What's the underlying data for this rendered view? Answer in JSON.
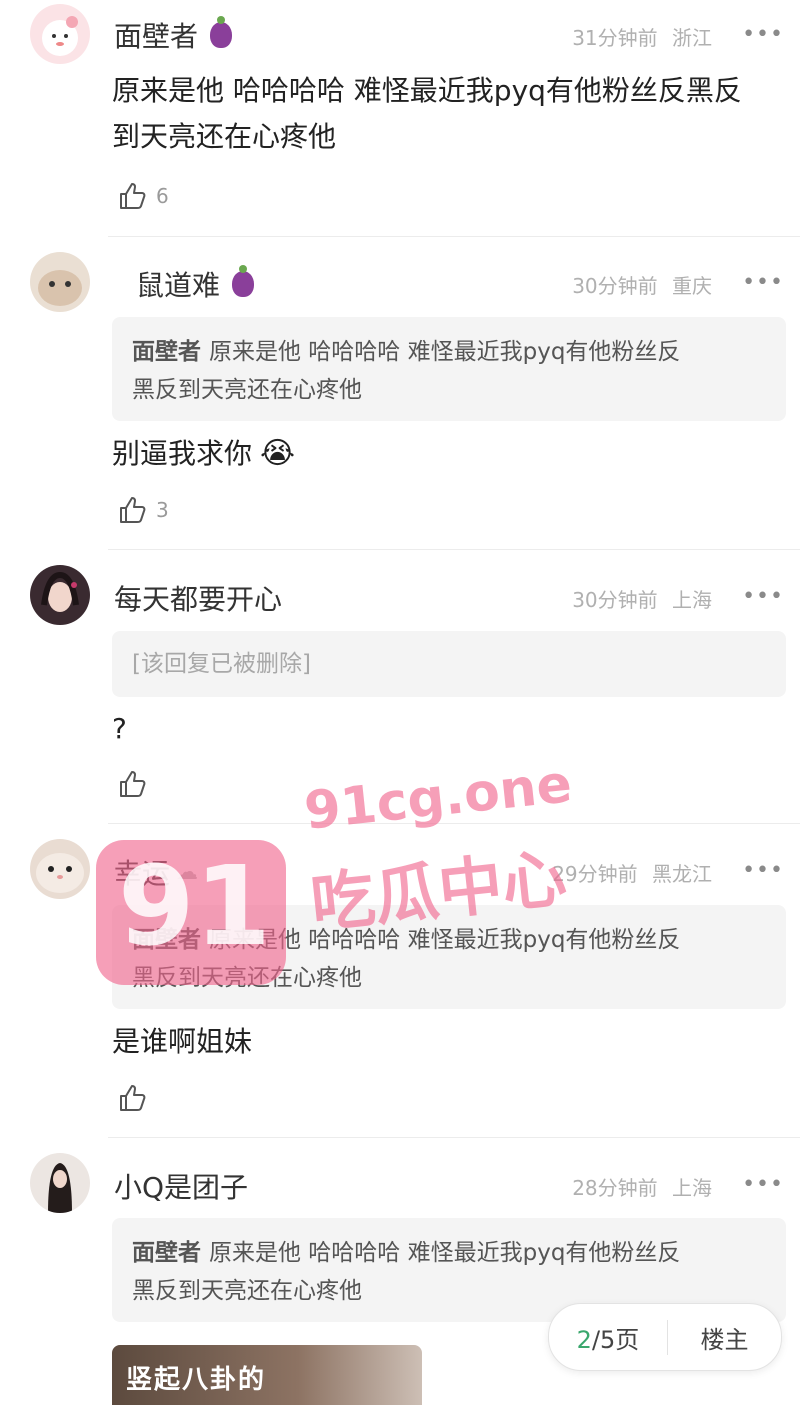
{
  "comments": [
    {
      "username": "面壁者",
      "time": "31分钟前",
      "location": "浙江",
      "text_lines": [
        "原来是他 哈哈哈哈 难怪最近我pyq有他粉丝反黑反",
        "到天亮还在心疼他"
      ],
      "likes": "6"
    },
    {
      "username": "鼠道难",
      "time": "30分钟前",
      "location": "重庆",
      "quote_name": "面壁者",
      "quote_lines": [
        "原来是他 哈哈哈哈 难怪最近我pyq有他粉丝反",
        "黑反到天亮还在心疼他"
      ],
      "text": "别逼我求你",
      "emoji": "😭",
      "likes": "3"
    },
    {
      "username": "每天都要开心",
      "time": "30分钟前",
      "location": "上海",
      "quote_deleted": "[该回复已被删除]",
      "text": "?"
    },
    {
      "username": "幸运",
      "time": "29分钟前",
      "location": "黑龙江",
      "quote_name": "面壁者",
      "quote_lines": [
        "原来是他 哈哈哈哈 难怪最近我pyq有他粉丝反",
        "黑反到天亮还在心疼他"
      ],
      "text": "是谁啊姐妹"
    },
    {
      "username": "小Q是团子",
      "time": "28分钟前",
      "location": "上海",
      "quote_name": "面壁者",
      "quote_lines": [
        "原来是他 哈哈哈哈 难怪最近我pyq有他粉丝反",
        "黑反到天亮还在心疼他"
      ],
      "image_text": "竖起八卦的"
    }
  ],
  "more_label": "•••",
  "pager": {
    "current": "2",
    "total": "/5页",
    "owner_label": "楼主"
  },
  "watermark": {
    "logo": "91",
    "domain": "91cg.one",
    "name": "吃瓜中心"
  },
  "colors": {
    "accent": "#3aa76d",
    "watermark": "#f0648c"
  }
}
